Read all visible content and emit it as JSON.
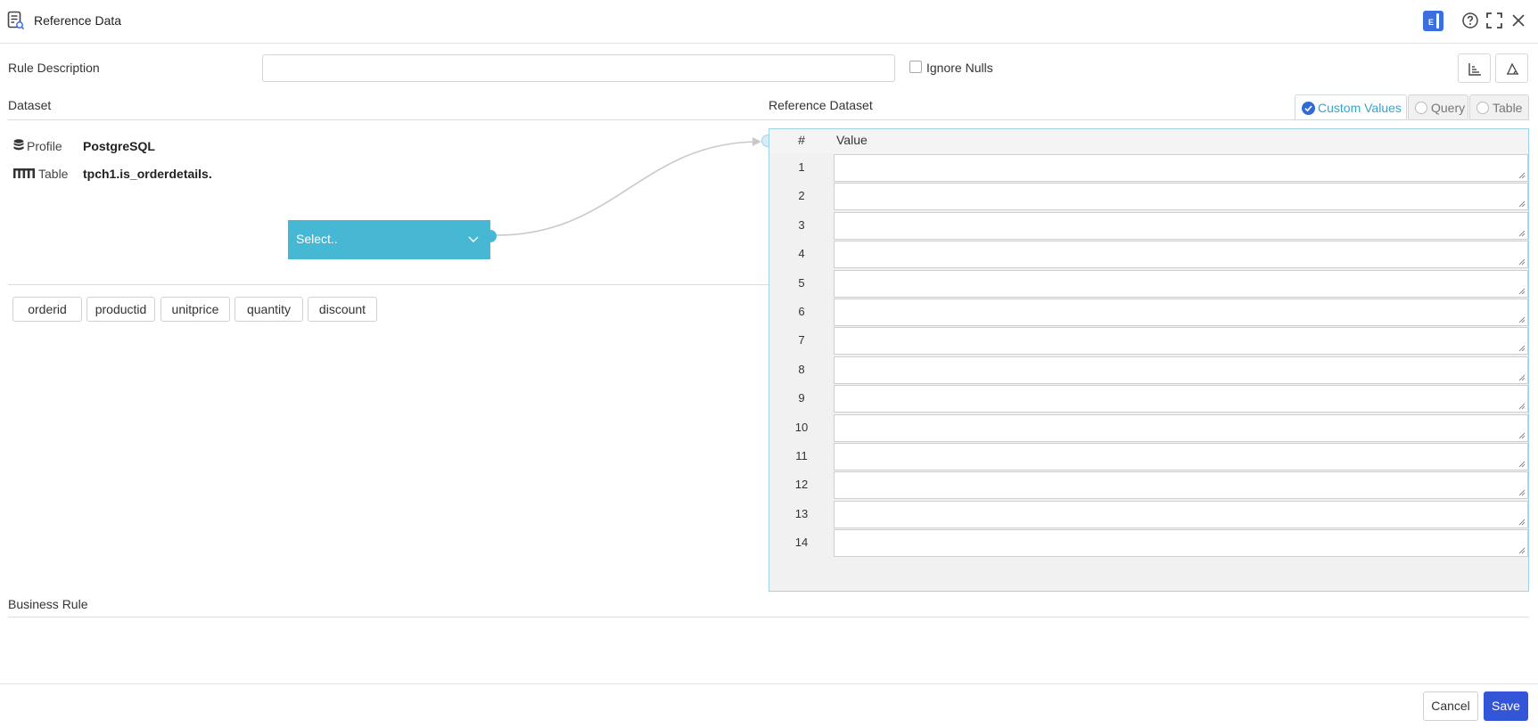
{
  "header": {
    "title": "Reference Data",
    "badge_letter": "E"
  },
  "form": {
    "rule_description_label": "Rule Description",
    "rule_description_value": "",
    "ignore_nulls_label": "Ignore Nulls",
    "ignore_nulls_checked": false
  },
  "dataset": {
    "section_label": "Dataset",
    "profile_label": "Profile",
    "profile_value": "PostgreSQL",
    "table_label": "Table",
    "table_value": "tpch1.is_orderdetails.",
    "select_placeholder": "Select..",
    "columns": [
      "orderid",
      "productid",
      "unitprice",
      "quantity",
      "discount"
    ]
  },
  "reference": {
    "section_label": "Reference Dataset",
    "tabs": [
      {
        "label": "Custom Values",
        "active": true
      },
      {
        "label": "Query",
        "active": false
      },
      {
        "label": "Table",
        "active": false
      }
    ],
    "grid": {
      "col_num": "#",
      "col_value": "Value",
      "rows": [
        "1",
        "2",
        "3",
        "4",
        "5",
        "6",
        "7",
        "8",
        "9",
        "10",
        "11",
        "12",
        "13",
        "14"
      ]
    }
  },
  "business_rule": {
    "section_label": "Business Rule"
  },
  "footer": {
    "cancel_label": "Cancel",
    "save_label": "Save"
  },
  "colors": {
    "accent": "#3356d9",
    "select_bg": "#47b8d3",
    "active_tab": "#2fa6d1"
  }
}
